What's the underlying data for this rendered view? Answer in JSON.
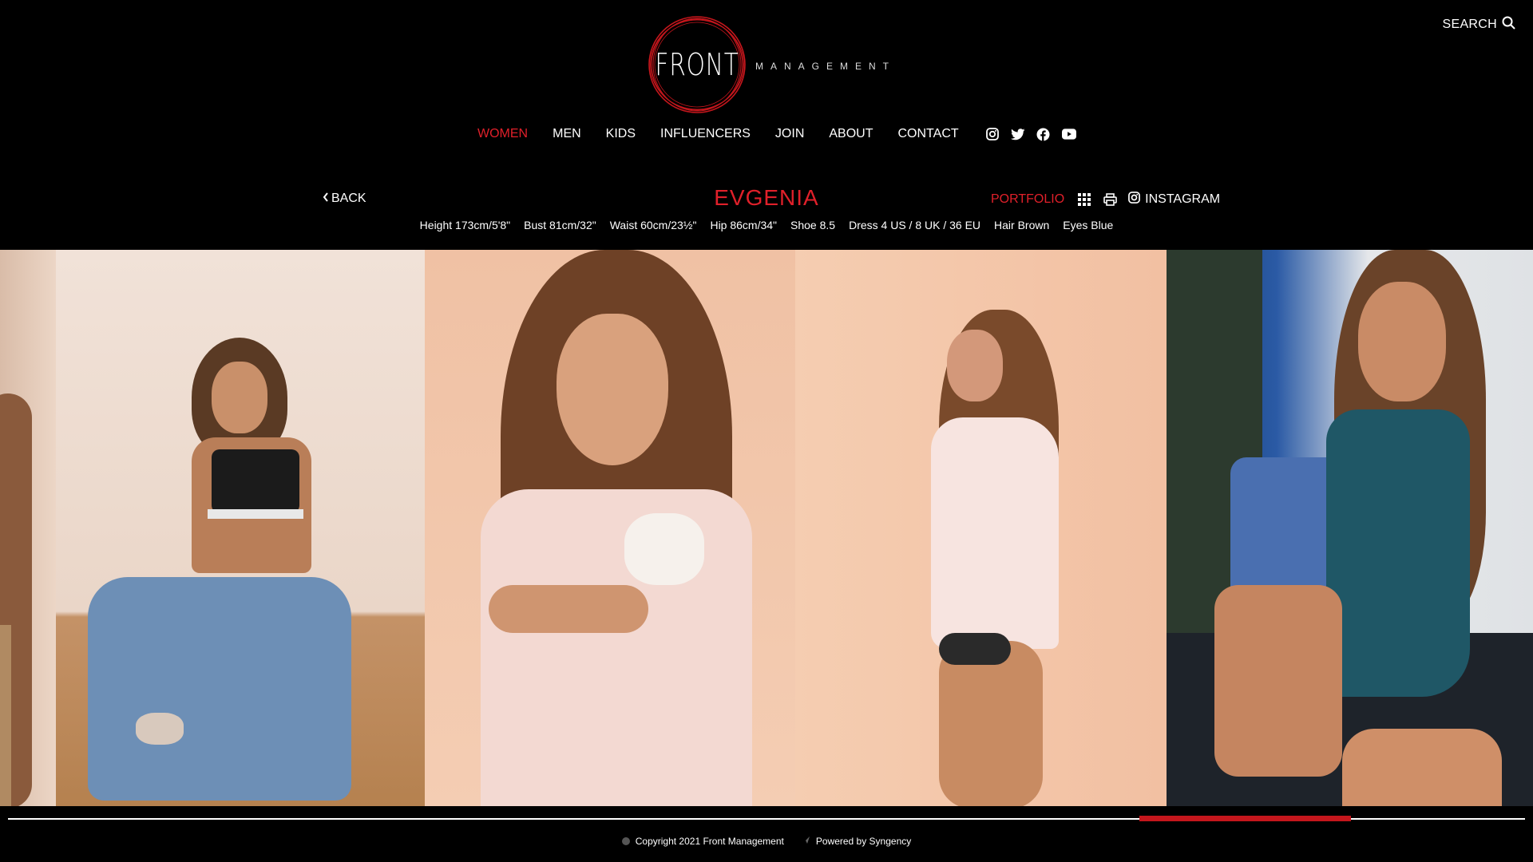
{
  "header": {
    "search_label": "SEARCH",
    "logo_main": "FRONT",
    "logo_sub": "MANAGEMENT",
    "nav": [
      {
        "label": "WOMEN",
        "active": true
      },
      {
        "label": "MEN"
      },
      {
        "label": "KIDS"
      },
      {
        "label": "INFLUENCERS"
      },
      {
        "label": "JOIN"
      },
      {
        "label": "ABOUT"
      },
      {
        "label": "CONTACT"
      }
    ],
    "social_icons": [
      "instagram-icon",
      "twitter-icon",
      "facebook-icon",
      "youtube-icon"
    ],
    "accent_color": "#e0202a"
  },
  "model": {
    "back_label": "BACK",
    "name": "EVGENIA",
    "portfolio_label": "PORTFOLIO",
    "instagram_label": "INSTAGRAM",
    "measurements": [
      "Height 173cm/5'8\"",
      "Bust 81cm/32\"",
      "Waist 60cm/23½\"",
      "Hip 86cm/34\"",
      "Shoe 8.5",
      "Dress 4 US / 8 UK / 36 EU",
      "Hair Brown",
      "Eyes Blue"
    ]
  },
  "gallery": {
    "photos": [
      {
        "name": "photo-partial-left",
        "bg": "#e9d3c3"
      },
      {
        "name": "photo-seated-jeans",
        "bg": "#efdcd0"
      },
      {
        "name": "photo-closeup-pink-shirt",
        "bg": "#f2c4a8"
      },
      {
        "name": "photo-over-shoulder",
        "bg": "#f3c9ac"
      },
      {
        "name": "photo-teal-swimsuit",
        "bg": "#1d2e3a"
      }
    ],
    "scroll_position": 0.82
  },
  "footer": {
    "copyright": "Copyright 2021 Front Management",
    "powered": "Powered by Syngency"
  }
}
